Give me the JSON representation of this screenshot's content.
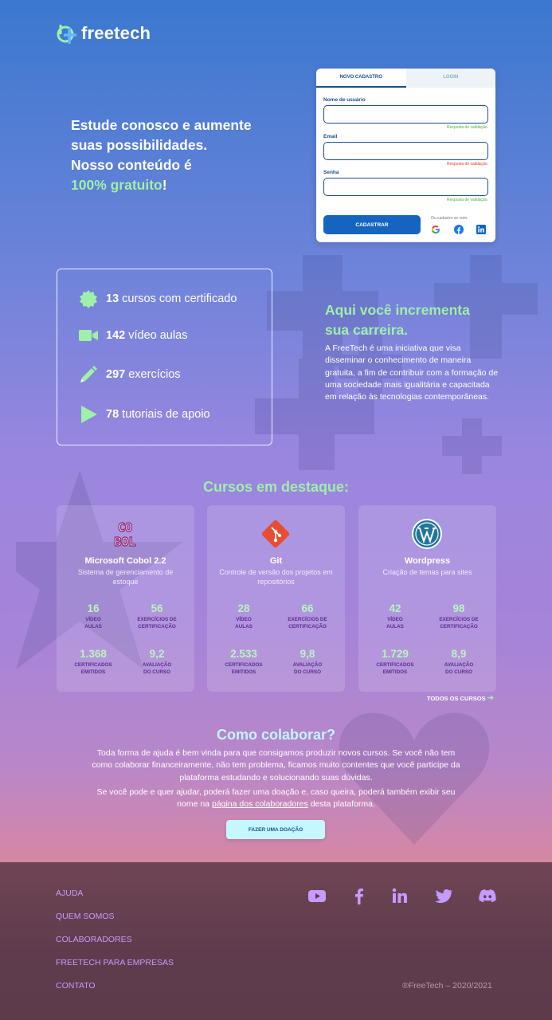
{
  "brand": {
    "name": "freetech"
  },
  "hero": {
    "line1": "Estude conosco e aumente",
    "line2": "suas possibilidades.",
    "line3": "Nosso conteúdo é",
    "highlight": "100% gratuito",
    "excl": "!"
  },
  "signup": {
    "tab_new": "NOVO CADASTRO",
    "tab_login": "LOGIN",
    "username_label": "Nome de usuário",
    "username_msg": "Resposta de validação.",
    "email_label": "Email",
    "email_msg": "Resposta de validação.",
    "password_label": "Senha",
    "password_msg": "Resposta de validação.",
    "submit": "CADASTRAR",
    "social_label": "Ou cadastre-se com:"
  },
  "stats": [
    {
      "num": "13",
      "label": " cursos com certificado",
      "icon": "badge-icon"
    },
    {
      "num": "142",
      "label": " vídeo aulas",
      "icon": "video-camera-icon"
    },
    {
      "num": "297",
      "label": " exercícios",
      "icon": "pencil-icon"
    },
    {
      "num": "78",
      "label": " tutoriais de apoio",
      "icon": "play-icon"
    }
  ],
  "career": {
    "title1": "Aqui você incrementa",
    "title2": "sua carreira.",
    "text": "A FreeTech é uma iniciativa que visa disseminar o conhecimento de maneira gratuita, a fim de contribuir com a formação de uma sociedade mais igualitária e capacitada em relação às tecnologias contemporâneas."
  },
  "featured": {
    "title": "Cursos em destaque:",
    "all_link": "TODOS OS CURSOS",
    "labels": {
      "videos1": "VÍDEO",
      "videos2": "AULAS",
      "ex1": "EXERCÍCIOS DE",
      "ex2": "CERTIFICAÇÃO",
      "cert1": "CERTIFICADOS",
      "cert2": "EMITIDOS",
      "rate1": "AVALIAÇÃO",
      "rate2": "DO CURSO"
    },
    "courses": [
      {
        "name": "Microsoft Cobol 2.2",
        "desc": "Sistema de gerenciamento de estoque",
        "icon_text": "CO\nBOL",
        "videos": "16",
        "exercises": "56",
        "certificates": "1.368",
        "rating": "9,2"
      },
      {
        "name": "Git",
        "desc": "Controle de versão dos projetos em repositórios",
        "videos": "28",
        "exercises": "66",
        "certificates": "2.533",
        "rating": "9,8"
      },
      {
        "name": "Wordpress",
        "desc": "Criação de temas para sites",
        "videos": "42",
        "exercises": "98",
        "certificates": "1.729",
        "rating": "8,9"
      }
    ]
  },
  "collab": {
    "title": "Como colaborar?",
    "p1": "Toda forma de ajuda é bem vinda para que consigamos produzir novos cursos. Se você não tem como colaborar financeiramente, não tem problema, ficamos muito contentes que você participe da plataforma estudando e solucionando suas dúvidas.",
    "p2_a": "Se você pode e quer ajudar, poderá fazer uma doação e, caso queira, poderá também exibir seu nome na ",
    "p2_link": "página dos colaboradores",
    "p2_b": " desta plataforma.",
    "donate": "FAZER UMA DOAÇÃO"
  },
  "footer": {
    "links": [
      "AJUDA",
      "QUEM SOMOS",
      "COLABORADORES",
      "FREETECH PARA EMPRESAS",
      "CONTATO"
    ],
    "copyright": "®FreeTech – 2020/2021"
  },
  "colors": {
    "accent_green": "#9ff0a8",
    "primary": "#1565c0",
    "footer_link": "#c49bff"
  }
}
